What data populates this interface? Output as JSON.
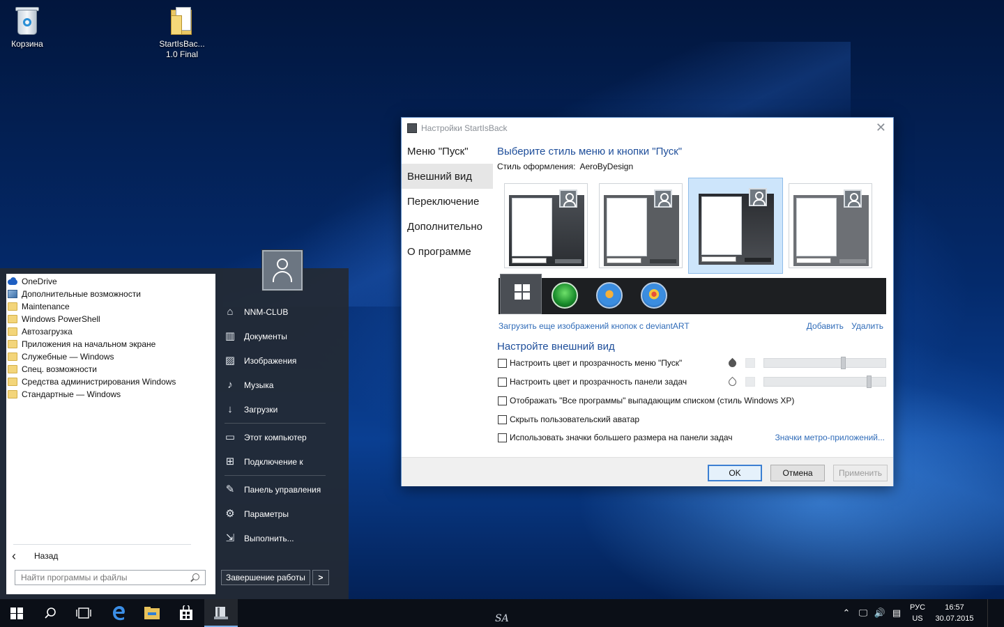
{
  "desktop": {
    "icons": [
      {
        "label": "Корзина"
      },
      {
        "label": "StartIsBac...",
        "label2": "1.0 Final"
      }
    ],
    "signature": "SA"
  },
  "start_menu": {
    "programs": [
      {
        "label": "OneDrive",
        "icon": "onedrive-icon"
      },
      {
        "label": "Дополнительные возможности",
        "icon": "app-icon"
      },
      {
        "label": "Maintenance",
        "icon": "folder-icon"
      },
      {
        "label": "Windows PowerShell",
        "icon": "folder-icon"
      },
      {
        "label": "Автозагрузка",
        "icon": "folder-icon"
      },
      {
        "label": "Приложения на начальном экране",
        "icon": "folder-icon"
      },
      {
        "label": "Служебные — Windows",
        "icon": "folder-icon"
      },
      {
        "label": "Спец. возможности",
        "icon": "folder-icon"
      },
      {
        "label": "Средства администрирования Windows",
        "icon": "folder-icon"
      },
      {
        "label": "Стандартные — Windows",
        "icon": "folder-icon"
      }
    ],
    "back_label": "Назад",
    "search_placeholder": "Найти программы и файлы",
    "places": [
      {
        "label": "NNM-CLUB",
        "icon": "user-folder-icon"
      },
      {
        "label": "Документы",
        "icon": "documents-icon"
      },
      {
        "label": "Изображения",
        "icon": "pictures-icon"
      },
      {
        "label": "Музыка",
        "icon": "music-icon"
      },
      {
        "label": "Загрузки",
        "icon": "downloads-icon"
      },
      {
        "label": "Этот компьютер",
        "icon": "computer-icon"
      },
      {
        "label": "Подключение к",
        "icon": "connect-icon"
      },
      {
        "label": "Панель управления",
        "icon": "control-panel-icon"
      },
      {
        "label": "Параметры",
        "icon": "settings-gear-icon"
      },
      {
        "label": "Выполнить...",
        "icon": "run-icon"
      }
    ],
    "shutdown_label": "Завершение работы",
    "shutdown_arrow": ">"
  },
  "dialog": {
    "title": "Настройки StartIsBack",
    "close": "✕",
    "nav": [
      {
        "label": "Меню \"Пуск\""
      },
      {
        "label": "Внешний вид"
      },
      {
        "label": "Переключение"
      },
      {
        "label": "Дополнительно"
      },
      {
        "label": "О программе"
      }
    ],
    "heading": "Выберите стиль меню и кнопки \"Пуск\"",
    "style_label": "Стиль оформления:",
    "style_value": "AeroByDesign",
    "selected_preview": 3,
    "orb_link": "Загрузить еще изображений кнопок с deviantART",
    "add_link": "Добавить",
    "remove_link": "Удалить",
    "appearance_heading": "Настройте внешний вид",
    "options": [
      {
        "label": "Настроить цвет и прозрачность меню \"Пуск\"",
        "checked": false
      },
      {
        "label": "Настроить цвет и прозрачность панели задач",
        "checked": false
      },
      {
        "label": "Отображать \"Все программы\" выпадающим списком (стиль Windows XP)",
        "checked": false
      },
      {
        "label": "Скрыть пользовательский аватар",
        "checked": false
      },
      {
        "label": "Использовать значки большего размера на панели задач",
        "checked": false
      }
    ],
    "menu_transparency": 0.66,
    "taskbar_transparency": 0.88,
    "metro_link": "Значки метро-приложений...",
    "ok": "OK",
    "cancel": "Отмена",
    "apply": "Применить"
  },
  "taskbar": {
    "lang_line1": "РУС",
    "lang_line2": "US",
    "time": "16:57",
    "date": "30.07.2015"
  },
  "colors": {
    "accent": "#1e4e9a",
    "link": "#2f6bb8"
  }
}
